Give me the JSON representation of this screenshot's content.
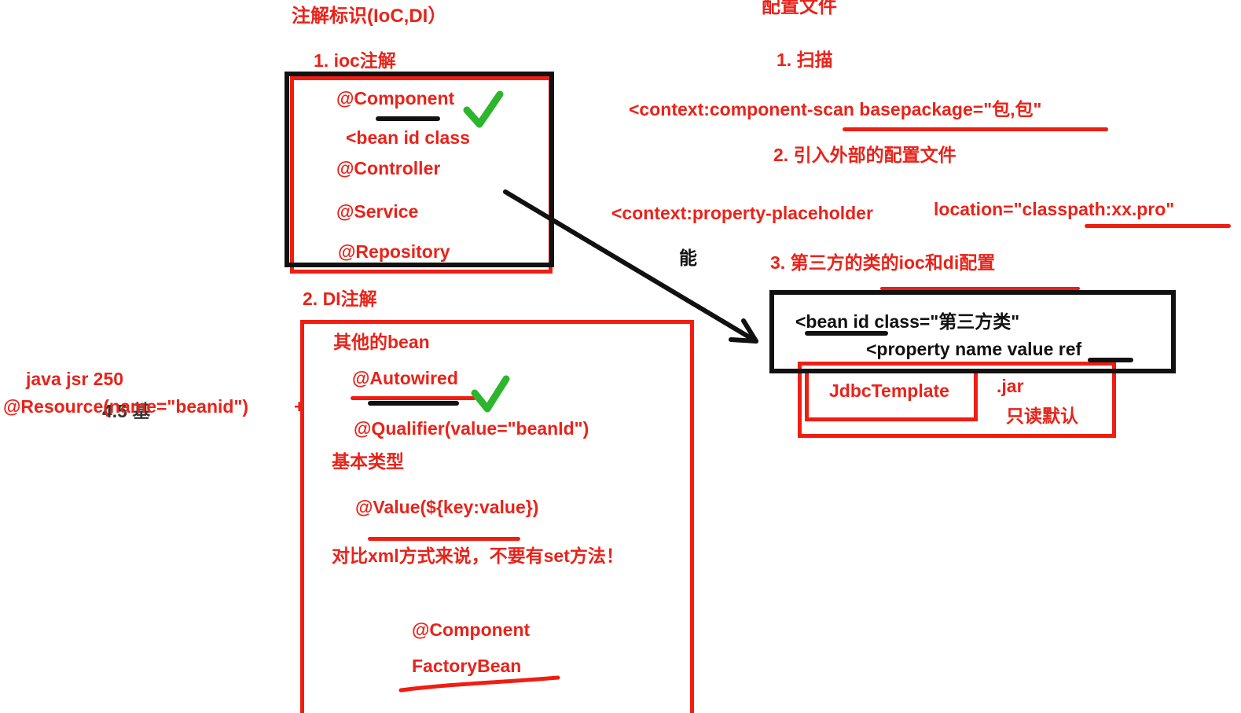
{
  "left": {
    "title": "注解标识(IoC,DI）",
    "ioc_heading": "1. ioc注解",
    "ioc_items": {
      "component": "@Component",
      "bean_id_class": "<bean id class",
      "controller": "@Controller",
      "service": "@Service",
      "repository": "@Repository"
    },
    "di_heading": "2. DI注解",
    "di_items": {
      "other_bean": "其他的bean",
      "autowired": "@Autowired",
      "qualifier": "@Qualifier(value=\"beanId\")",
      "basic_type": "基本类型",
      "value": "@Value(${key:value})",
      "compare": "对比xml方式来说，不要有set方法！",
      "component2": "@Component",
      "factory_bean": "FactoryBean"
    },
    "jsr_label": "java jsr 250",
    "resource": "@Resource(name=\"beanid\")",
    "overlap_fragment": "4.5 基"
  },
  "right": {
    "title": "配置文件",
    "scan_heading": "1. 扫描",
    "scan_xml": "<context:component-scan  basepackage=\"包,包\"",
    "external_heading": "2. 引入外部的配置文件",
    "placeholder_xml": "<context:property-placeholder",
    "location_xml": "location=\"classpath:xx.pro\"",
    "neng": "能",
    "third_heading": "3. 第三方的类的ioc和di配置",
    "bean_xml": "<bean id class=\"第三方类\"",
    "property_xml": "<property name value ref",
    "jdbc": "JdbcTemplate",
    "jar": ".jar",
    "readonly": "只读默认"
  },
  "colors": {
    "accent_red": "#e8231a",
    "box_black": "#111111",
    "check_green": "#2db52d"
  },
  "icons": [
    "checkmark-icon",
    "checkmark-icon",
    "arrow-icon"
  ]
}
